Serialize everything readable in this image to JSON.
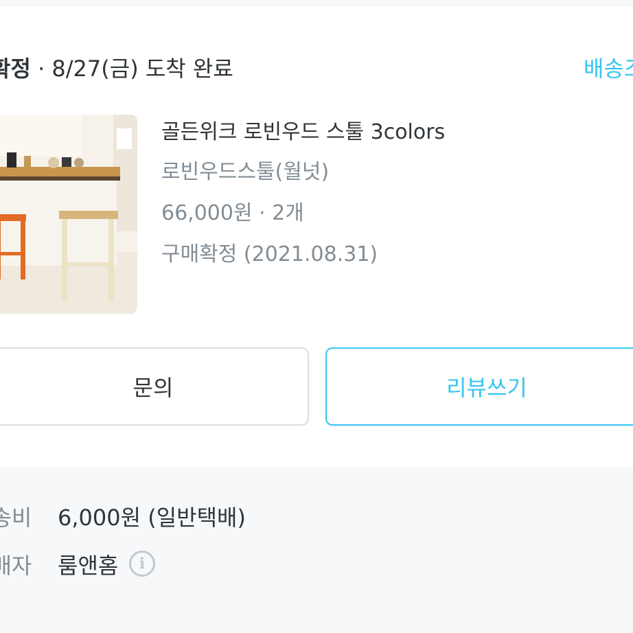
{
  "order": {
    "status_strong": "확정",
    "status_rest": " · 8/27(금) 도착 완료",
    "delivery_link": "배송조"
  },
  "product": {
    "name": "골든위크 로빈우드 스툴 3colors",
    "option": "로빈우드스툴(월넛)",
    "price_qty": "66,000원 · 2개",
    "purchase_confirm": "구매확정 (2021.08.31)"
  },
  "actions": {
    "inquiry": "문의",
    "review": "리뷰쓰기"
  },
  "details": {
    "shipping_label": "배송비",
    "shipping_value": "6,000원 (일반택배)",
    "seller_label": "판매자",
    "seller_value": "룸앤홈"
  },
  "icons": {
    "info": "info-circle-icon"
  },
  "colors": {
    "accent": "#35c5f0",
    "text": "#2f3438",
    "muted": "#828c94",
    "background": "#f7f8fa"
  }
}
